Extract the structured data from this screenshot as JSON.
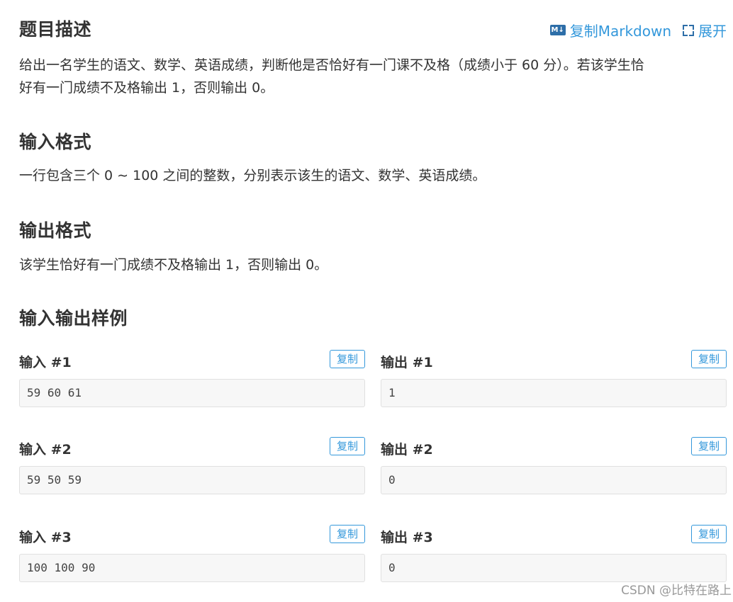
{
  "header": {
    "title": "题目描述",
    "copy_markdown": "复制Markdown",
    "expand": "展开"
  },
  "description": {
    "line1": "给出一名学生的语文、数学、英语成绩，判断他是否恰好有一门课不及格（成绩小于 60 分）。若该学生恰",
    "line2": "好有一门成绩不及格输出 1，否则输出 0。"
  },
  "input_format": {
    "title": "输入格式",
    "text": "一行包含三个 0 ∼ 100 之间的整数，分别表示该生的语文、数学、英语成绩。"
  },
  "output_format": {
    "title": "输出格式",
    "text": "该学生恰好有一门成绩不及格输出 1，否则输出 0。"
  },
  "samples": {
    "title": "输入输出样例",
    "copy_label": "复制",
    "items": [
      {
        "input_label": "输入 #1",
        "input": "59 60 61",
        "output_label": "输出 #1",
        "output": "1"
      },
      {
        "input_label": "输入 #2",
        "input": "59 50 59",
        "output_label": "输出 #2",
        "output": "0"
      },
      {
        "input_label": "输入 #3",
        "input": "100 100 90",
        "output_label": "输出 #3",
        "output": "0"
      }
    ]
  },
  "watermark": "CSDN @比特在路上",
  "colors": {
    "accent": "#3498db",
    "icon": "#2d6ea8",
    "code_bg": "#f7f7f7"
  }
}
